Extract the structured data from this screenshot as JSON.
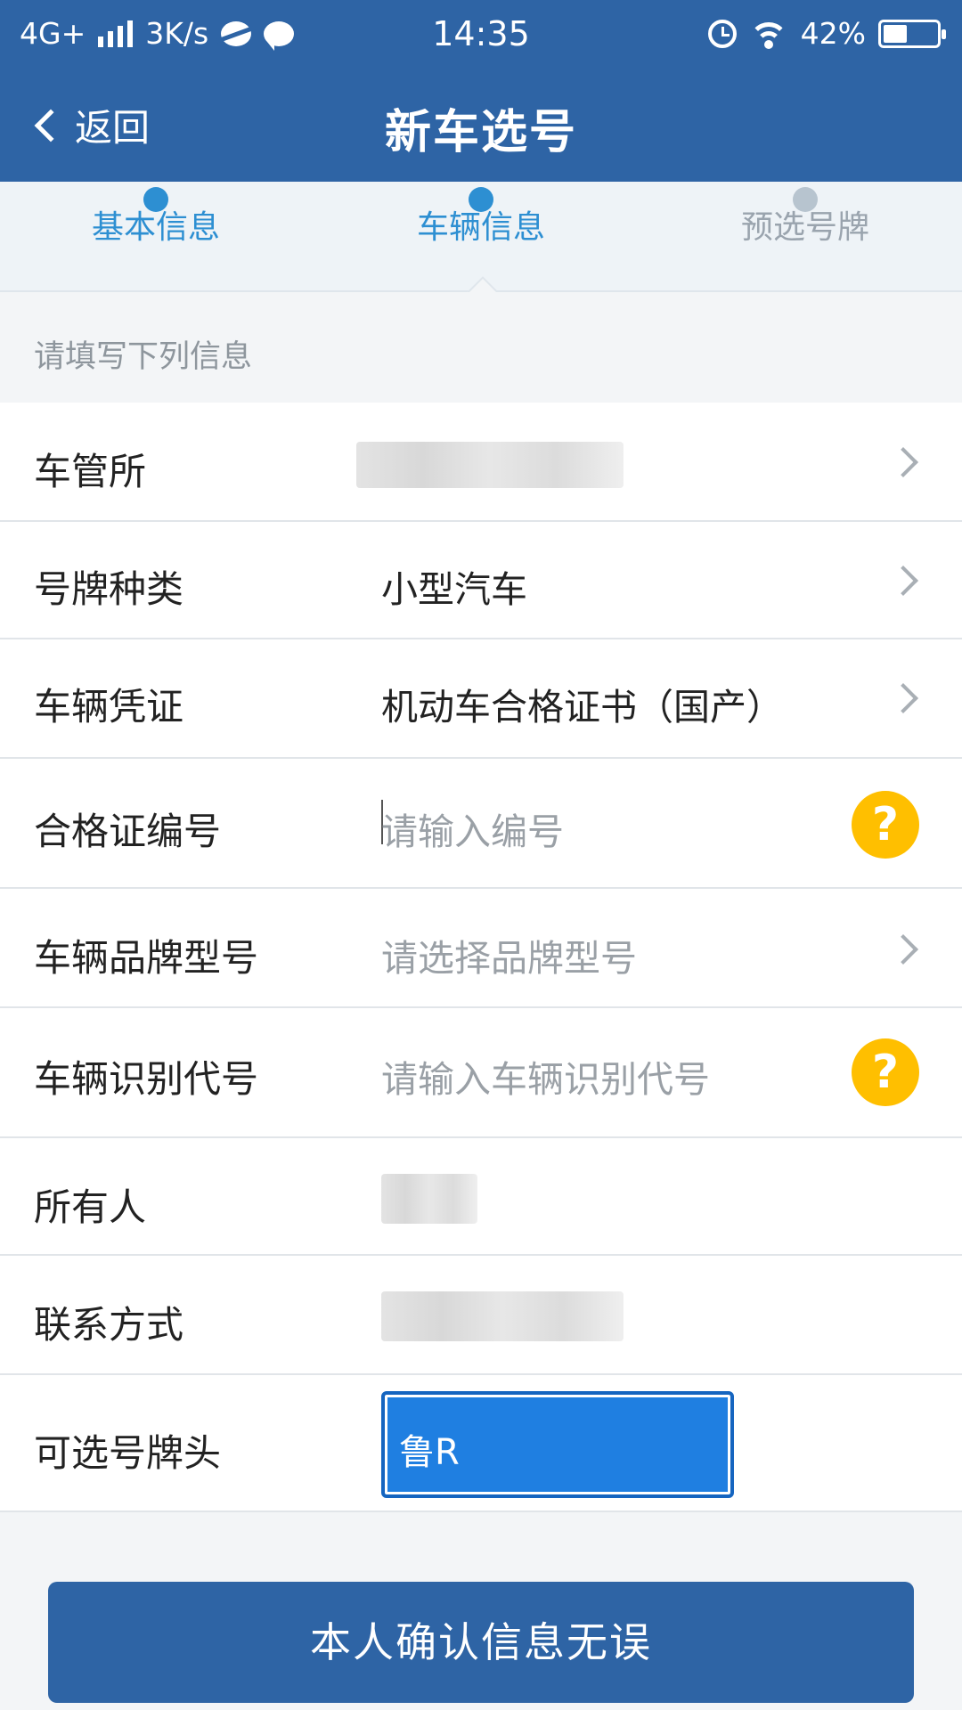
{
  "status_bar": {
    "network": "4G+",
    "speed": "3K/s",
    "time": "14:35",
    "battery": "42%"
  },
  "nav": {
    "back_label": "返回",
    "title": "新车选号"
  },
  "steps": [
    {
      "label": "基本信息",
      "state": "done"
    },
    {
      "label": "车辆信息",
      "state": "current"
    },
    {
      "label": "预选号牌",
      "state": "pending"
    }
  ],
  "hint": "请填写下列信息",
  "form": {
    "station": {
      "label": "车管所",
      "value": ""
    },
    "plate_type": {
      "label": "号牌种类",
      "value": "小型汽车"
    },
    "vehicle_doc": {
      "label": "车辆凭证",
      "value": "机动车合格证书（国产）"
    },
    "cert_no": {
      "label": "合格证编号",
      "placeholder": "请输入编号"
    },
    "brand_model": {
      "label": "车辆品牌型号",
      "placeholder": "请选择品牌型号"
    },
    "vin": {
      "label": "车辆识别代号",
      "placeholder": "请输入车辆识别代号"
    },
    "owner": {
      "label": "所有人",
      "value": ""
    },
    "contact": {
      "label": "联系方式",
      "value": ""
    },
    "plate_prefix": {
      "label": "可选号牌头",
      "value": "鲁R"
    }
  },
  "confirm_label": "本人确认信息无误",
  "icons": {
    "back": "chevron-left-icon",
    "arrow": "chevron-right-icon",
    "help": "question-icon"
  },
  "colors": {
    "primary": "#2e64a5",
    "step_active": "#2d8fd2",
    "help": "#ffbf00",
    "plate": "#1f7fe1"
  }
}
